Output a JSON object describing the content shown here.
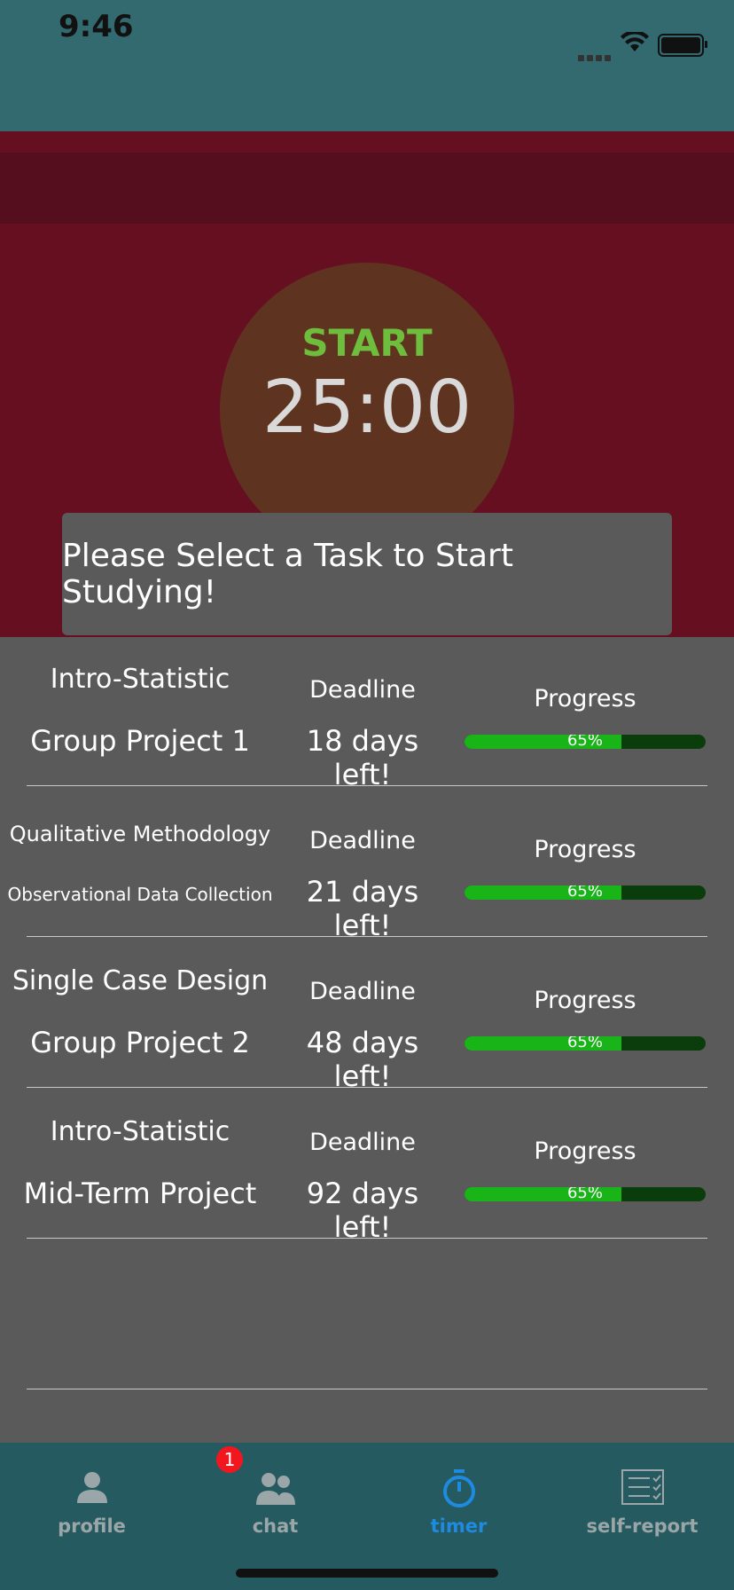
{
  "status_bar": {
    "time": "9:46"
  },
  "timer": {
    "start_label": "START",
    "time_remaining": "25:00"
  },
  "prompt": {
    "text": "Please Select a Task to Start Studying!"
  },
  "tasks": [
    {
      "course": "Intro-Statistic",
      "project": "Group Project 1",
      "deadline_label": "Deadline",
      "deadline": "18 days left!",
      "progress_label": "Progress",
      "progress_text": "65%",
      "progress": 0.65
    },
    {
      "course": "Qualitative Methodology",
      "project": "Observational Data Collection",
      "deadline_label": "Deadline",
      "deadline": "21 days left!",
      "progress_label": "Progress",
      "progress_text": "65%",
      "progress": 0.65
    },
    {
      "course": "Single Case Design",
      "project": "Group Project 2",
      "deadline_label": "Deadline",
      "deadline": "48 days left!",
      "progress_label": "Progress",
      "progress_text": "65%",
      "progress": 0.65
    },
    {
      "course": "Intro-Statistic",
      "project": "Mid-Term Project",
      "deadline_label": "Deadline",
      "deadline": "92 days left!",
      "progress_label": "Progress",
      "progress_text": "65%",
      "progress": 0.65
    }
  ],
  "tabs": [
    {
      "label": "profile",
      "icon": "person-icon"
    },
    {
      "label": "chat",
      "icon": "chat-icon",
      "badge": "1"
    },
    {
      "label": "timer",
      "icon": "stopwatch-icon",
      "active": true
    },
    {
      "label": "self-report",
      "icon": "report-icon"
    }
  ],
  "colors": {
    "header": "#336a70",
    "timer_background": "#660f20",
    "start": "#6ebd3c",
    "progress_fill": "#18b418",
    "active_tab": "#1e8ae0",
    "badge": "#f2161f"
  }
}
